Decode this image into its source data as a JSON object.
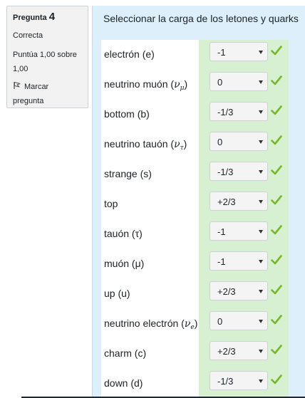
{
  "info": {
    "question_label": "Pregunta",
    "question_number": "4",
    "state": "Correcta",
    "grade_line1": "Puntúa 1,00 sobre",
    "grade_line2": "1,00",
    "flag_line1": "Marcar",
    "flag_line2": "pregunta",
    "flag_icon": "flag-icon"
  },
  "question_text": "Seleccionar la carga de los letones y quarks",
  "rows": [
    {
      "label": "electrón (e)",
      "symbol": "",
      "sub": "",
      "close": "",
      "value": "-1"
    },
    {
      "label": "neutrino muón (",
      "symbol": "ν",
      "sub": "μ",
      "close": ")",
      "value": "0"
    },
    {
      "label": "bottom (b)",
      "symbol": "",
      "sub": "",
      "close": "",
      "value": "-1/3"
    },
    {
      "label": "neutrino tauón (",
      "symbol": "ν",
      "sub": "τ",
      "close": ")",
      "value": "0"
    },
    {
      "label": "strange (s)",
      "symbol": "",
      "sub": "",
      "close": "",
      "value": "-1/3"
    },
    {
      "label": "top",
      "symbol": "",
      "sub": "",
      "close": "",
      "value": "+2/3"
    },
    {
      "label": "tauón (τ)",
      "symbol": "",
      "sub": "",
      "close": "",
      "value": "-1"
    },
    {
      "label": "muón (μ)",
      "symbol": "",
      "sub": "",
      "close": "",
      "value": "-1"
    },
    {
      "label": "up (u)",
      "symbol": "",
      "sub": "",
      "close": "",
      "value": "+2/3"
    },
    {
      "label": "neutrino electrón (",
      "symbol": "ν",
      "sub": "e",
      "close": ")",
      "value": "0"
    },
    {
      "label": "charm (c)",
      "symbol": "",
      "sub": "",
      "close": "",
      "value": "+2/3"
    },
    {
      "label": "down (d)",
      "symbol": "",
      "sub": "",
      "close": "",
      "value": "-1/3"
    }
  ],
  "colors": {
    "content_bg": "#dceffa",
    "answer_bg": "#d8f0d2",
    "check": "#75b829"
  },
  "icons": {
    "check": "check-icon",
    "caret": "chevron-down-icon"
  }
}
